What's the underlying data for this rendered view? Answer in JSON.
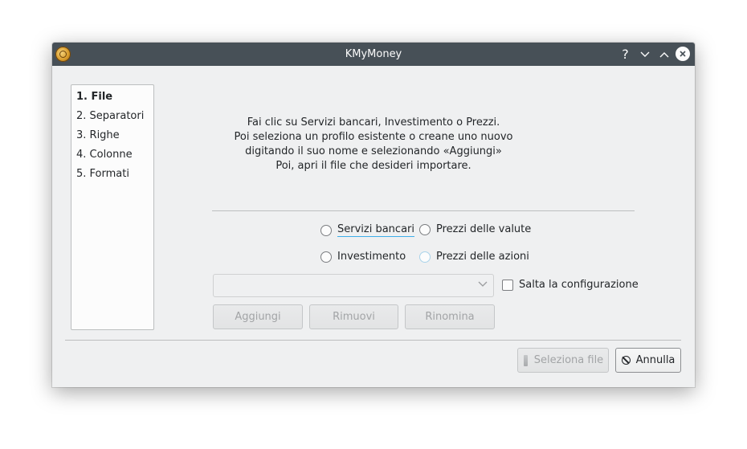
{
  "window": {
    "title": "KMyMoney"
  },
  "titlebar_buttons": {
    "help": "?",
    "minimize": "⌄",
    "maximize": "⌃",
    "close": "✕"
  },
  "steps": [
    {
      "label": "1. File",
      "active": true
    },
    {
      "label": "2. Separatori"
    },
    {
      "label": "3. Righe"
    },
    {
      "label": "4. Colonne"
    },
    {
      "label": "5. Formati"
    }
  ],
  "intro": {
    "line1": "Fai clic su Servizi bancari, Investimento o Prezzi.",
    "line2": "Poi seleziona un profilo esistente o creane uno nuovo",
    "line3": "digitando il suo nome e selezionando «Aggiungi»",
    "line4": "Poi, apri il file che desideri importare."
  },
  "options": {
    "banking": "Servizi bancari",
    "currency_prices": "Prezzi delle valute",
    "investment": "Investimento",
    "stock_prices": "Prezzi delle azioni"
  },
  "profile": {
    "value": "",
    "skip_setup": "Salta la configurazione"
  },
  "profile_buttons": {
    "add": "Aggiungi",
    "remove": "Rimuovi",
    "rename": "Rinomina"
  },
  "footer": {
    "select_file": "Seleziona file",
    "cancel": "Annulla"
  }
}
